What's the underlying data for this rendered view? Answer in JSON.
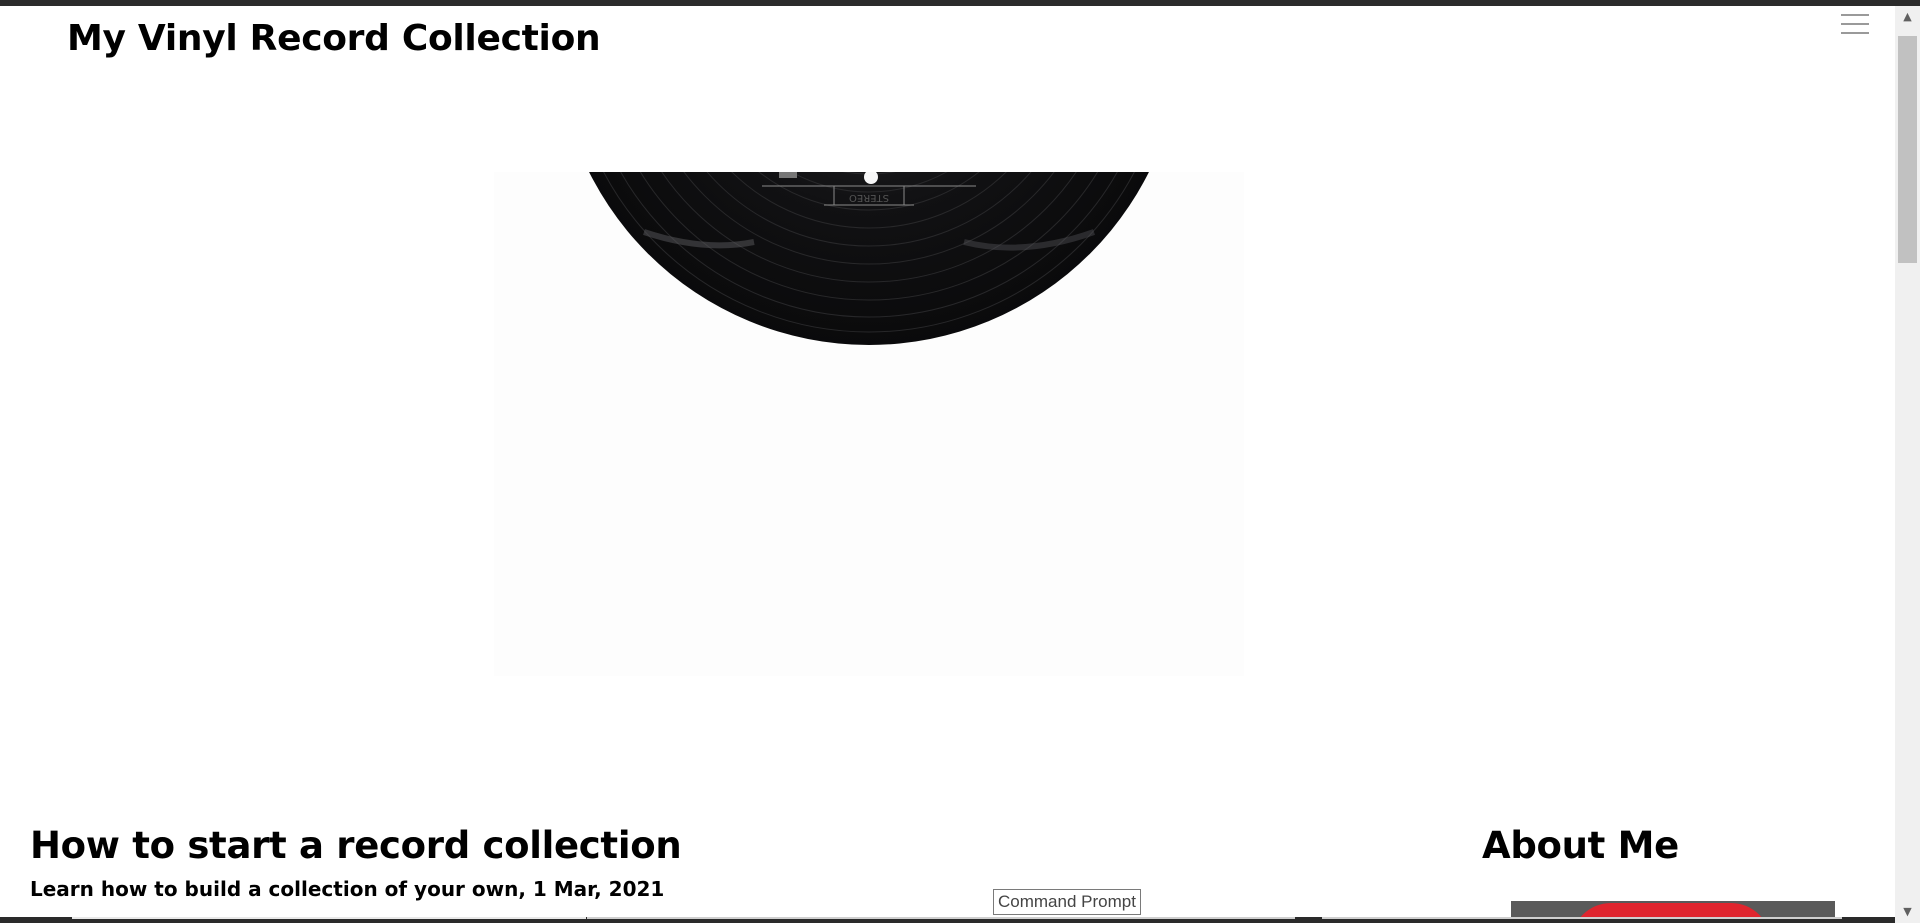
{
  "header": {
    "site_title": "My Vinyl Record Collection",
    "menu_icon": "hamburger-menu-icon"
  },
  "hero": {
    "label_text": "STEREO",
    "image": "vinyl-record"
  },
  "post": {
    "title": "How to start a record collection",
    "subtitle": "Learn how to build a collection of your own, 1 Mar, 2021"
  },
  "about": {
    "title": "About Me",
    "image": "profile-photo"
  },
  "tooltip": {
    "text": "Command Prompt"
  },
  "scrollbar": {
    "up_icon": "▲",
    "down_icon": "▼"
  },
  "colors": {
    "background": "#ffffff",
    "text": "#000000",
    "record": "#0f0f10",
    "label": "#e4e6e3"
  }
}
